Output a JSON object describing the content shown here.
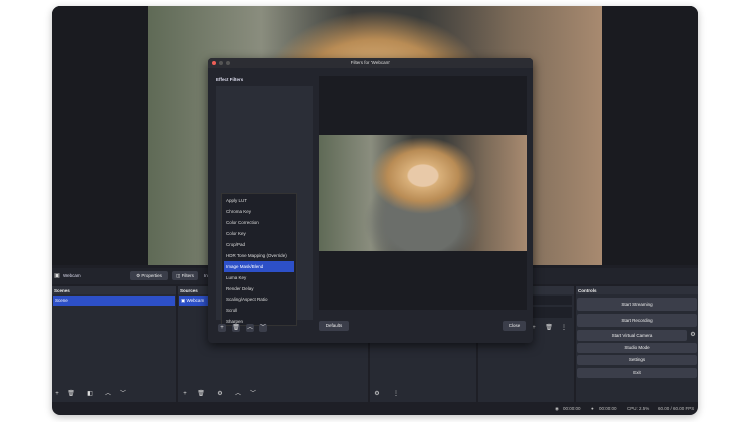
{
  "main": {
    "source_name": "Webcam",
    "properties_label": "Properties",
    "filters_label": "Filters",
    "partial_tab": "In"
  },
  "scenes": {
    "title": "Scenes",
    "items": [
      "Scene"
    ]
  },
  "sources": {
    "title": "Sources",
    "items": [
      "Webcam"
    ]
  },
  "controls": {
    "title": "Controls",
    "buttons": [
      "Start Streaming",
      "Start Recording",
      "Start Virtual Camera",
      "Studio Mode",
      "Settings",
      "Exit"
    ]
  },
  "status": {
    "stream_time": "00:00:00",
    "record_time": "00:00:00",
    "cpu": "CPU: 2.5%",
    "fps": "60.00 / 60.00 FPS"
  },
  "dialog": {
    "title": "Filters for 'Webcam'",
    "section": "Effect Filters",
    "defaults_label": "Defaults",
    "close_label": "Close",
    "menu": [
      "Apply LUT",
      "Chroma Key",
      "Color Correction",
      "Color Key",
      "Crop/Pad",
      "HDR Tone Mapping (Override)",
      "Image Mask/Blend",
      "Luma Key",
      "Render Delay",
      "Scaling/Aspect Ratio",
      "Scroll",
      "Sharpen"
    ],
    "menu_selected": 6
  },
  "colors": {
    "accent": "#2d50c8",
    "bg": "#1e1f26"
  }
}
